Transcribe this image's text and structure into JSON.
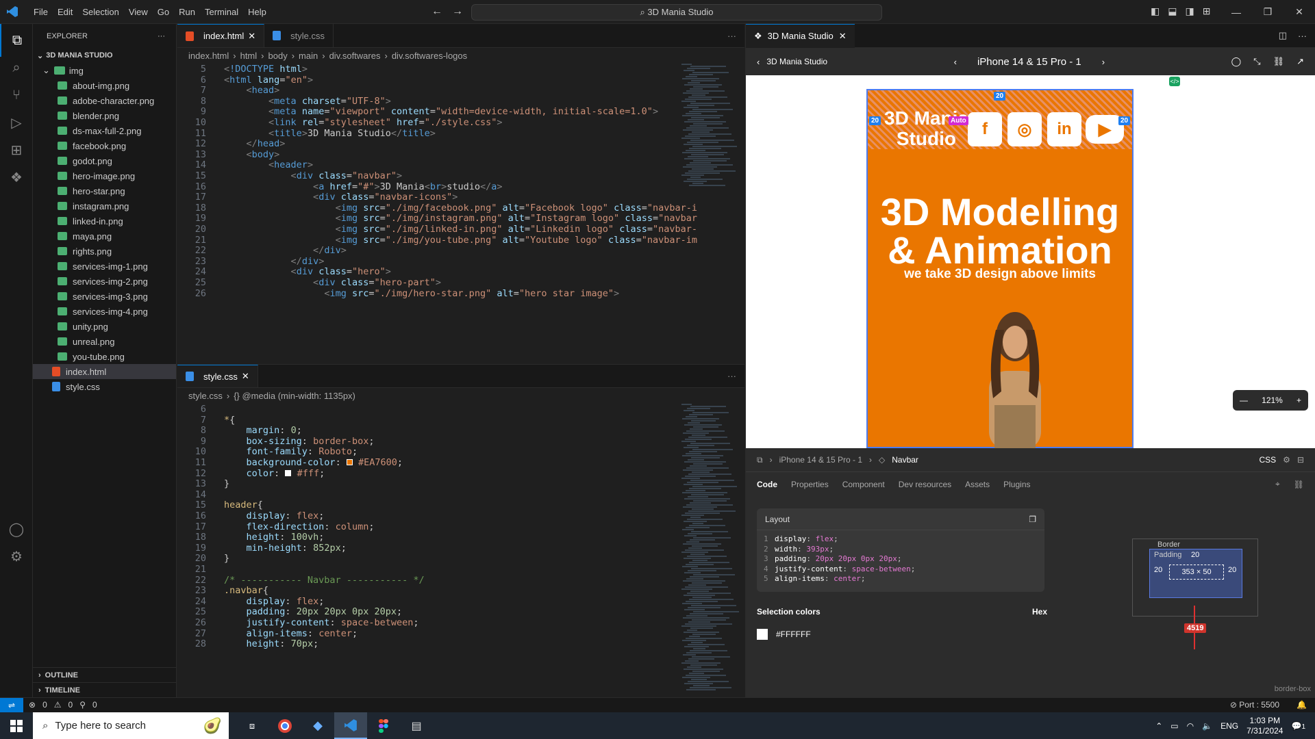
{
  "menu": [
    "File",
    "Edit",
    "Selection",
    "View",
    "Go",
    "Run",
    "Terminal",
    "Help"
  ],
  "command_center": "3D Mania Studio",
  "explorer": {
    "title": "EXPLORER",
    "project": "3D MANIA STUDIO",
    "folder": "img",
    "files": [
      "about-img.png",
      "adobe-character.png",
      "blender.png",
      "ds-max-full-2.png",
      "facebook.png",
      "godot.png",
      "hero-image.png",
      "hero-star.png",
      "instagram.png",
      "linked-in.png",
      "maya.png",
      "rights.png",
      "services-img-1.png",
      "services-img-2.png",
      "services-img-3.png",
      "services-img-4.png",
      "unity.png",
      "unreal.png",
      "you-tube.png"
    ],
    "root_files": [
      "index.html",
      "style.css"
    ],
    "outline": "OUTLINE",
    "timeline": "TIMELINE"
  },
  "editor_top": {
    "tabs": [
      "index.html",
      "style.css"
    ],
    "crumbs": [
      "index.html",
      "html",
      "body",
      "main",
      "div.softwares",
      "div.softwares-logos"
    ],
    "lines": [
      {
        "n": "5",
        "h": "<span class='gy'>&lt;</span><span class='tg'>!DOCTYPE</span> <span class='at'>html</span><span class='gy'>&gt;</span>"
      },
      {
        "n": "6",
        "h": "<span class='gy'>&lt;</span><span class='tg'>html</span> <span class='at'>lang</span>=<span class='st'>\"en\"</span><span class='gy'>&gt;</span>"
      },
      {
        "n": "7",
        "h": "    <span class='gy'>&lt;</span><span class='tg'>head</span><span class='gy'>&gt;</span>"
      },
      {
        "n": "8",
        "h": "        <span class='gy'>&lt;</span><span class='tg'>meta</span> <span class='at'>charset</span>=<span class='st'>\"UTF-8\"</span><span class='gy'>&gt;</span>"
      },
      {
        "n": "9",
        "h": "        <span class='gy'>&lt;</span><span class='tg'>meta</span> <span class='at'>name</span>=<span class='st'>\"viewport\"</span> <span class='at'>content</span>=<span class='st'>\"width=device-width, initial-scale=1.0\"</span><span class='gy'>&gt;</span>"
      },
      {
        "n": "10",
        "h": "        <span class='gy'>&lt;</span><span class='tg'>link</span> <span class='at'>rel</span>=<span class='st'>\"stylesheet\"</span> <span class='at'>href</span>=<span class='st'>\"./style.css\"</span><span class='gy'>&gt;</span>"
      },
      {
        "n": "11",
        "h": "        <span class='gy'>&lt;</span><span class='tg'>title</span><span class='gy'>&gt;</span>3D Mania Studio<span class='gy'>&lt;/</span><span class='tg'>title</span><span class='gy'>&gt;</span>"
      },
      {
        "n": "12",
        "h": "    <span class='gy'>&lt;/</span><span class='tg'>head</span><span class='gy'>&gt;</span>"
      },
      {
        "n": "13",
        "h": "    <span class='gy'>&lt;</span><span class='tg'>body</span><span class='gy'>&gt;</span>"
      },
      {
        "n": "14",
        "h": "        <span class='gy'>&lt;</span><span class='tg'>header</span><span class='gy'>&gt;</span>"
      },
      {
        "n": "15",
        "h": "            <span class='gy'>&lt;</span><span class='tg'>div</span> <span class='at'>class</span>=<span class='st'>\"navbar\"</span><span class='gy'>&gt;</span>"
      },
      {
        "n": "16",
        "h": "                <span class='gy'>&lt;</span><span class='tg'>a</span> <span class='at'>href</span>=<span class='st'>\"#\"</span><span class='gy'>&gt;</span>3D Mania<span class='gy'>&lt;</span><span class='tg'>br</span><span class='gy'>&gt;</span>studio<span class='gy'>&lt;/</span><span class='tg'>a</span><span class='gy'>&gt;</span>"
      },
      {
        "n": "17",
        "h": "                <span class='gy'>&lt;</span><span class='tg'>div</span> <span class='at'>class</span>=<span class='st'>\"navbar-icons\"</span><span class='gy'>&gt;</span>"
      },
      {
        "n": "18",
        "h": "                    <span class='gy'>&lt;</span><span class='tg'>img</span> <span class='at'>src</span>=<span class='st'>\"./img/facebook.png\"</span> <span class='at'>alt</span>=<span class='st'>\"Facebook logo\"</span> <span class='at'>class</span>=<span class='st'>\"navbar-i</span>"
      },
      {
        "n": "19",
        "h": "                    <span class='gy'>&lt;</span><span class='tg'>img</span> <span class='at'>src</span>=<span class='st'>\"./img/instagram.png\"</span> <span class='at'>alt</span>=<span class='st'>\"Instagram logo\"</span> <span class='at'>class</span>=<span class='st'>\"navbar</span>"
      },
      {
        "n": "20",
        "h": "                    <span class='gy'>&lt;</span><span class='tg'>img</span> <span class='at'>src</span>=<span class='st'>\"./img/linked-in.png\"</span> <span class='at'>alt</span>=<span class='st'>\"Linkedin logo\"</span> <span class='at'>class</span>=<span class='st'>\"navbar-</span>"
      },
      {
        "n": "21",
        "h": "                    <span class='gy'>&lt;</span><span class='tg'>img</span> <span class='at'>src</span>=<span class='st'>\"./img/you-tube.png\"</span> <span class='at'>alt</span>=<span class='st'>\"Youtube logo\"</span> <span class='at'>class</span>=<span class='st'>\"navbar-im</span>"
      },
      {
        "n": "22",
        "h": "                <span class='gy'>&lt;/</span><span class='tg'>div</span><span class='gy'>&gt;</span>"
      },
      {
        "n": "23",
        "h": "            <span class='gy'>&lt;/</span><span class='tg'>div</span><span class='gy'>&gt;</span>"
      },
      {
        "n": "24",
        "h": "            <span class='gy'>&lt;</span><span class='tg'>div</span> <span class='at'>class</span>=<span class='st'>\"hero\"</span><span class='gy'>&gt;</span>"
      },
      {
        "n": "25",
        "h": "                <span class='gy'>&lt;</span><span class='tg'>div</span> <span class='at'>class</span>=<span class='st'>\"hero-part\"</span><span class='gy'>&gt;</span>"
      },
      {
        "n": "26",
        "h": "                  <span class='gy'>&lt;</span><span class='tg'>img</span> <span class='at'>src</span>=<span class='st'>\"./img/hero-star.png\"</span> <span class='at'>alt</span>=<span class='st'>\"hero star image\"</span><span class='gy'>&gt;</span>"
      }
    ]
  },
  "editor_bottom": {
    "tab": "style.css",
    "crumbs": [
      "style.css",
      "{} @media (min-width: 1135px)"
    ],
    "lines": [
      {
        "n": "6",
        "h": ""
      },
      {
        "n": "7",
        "h": "<span class='sel'>*</span>{"
      },
      {
        "n": "8",
        "h": "    <span class='pr'>margin</span>: <span class='nm'>0</span>;"
      },
      {
        "n": "9",
        "h": "    <span class='pr'>box-sizing</span>: <span class='vl'>border-box</span>;"
      },
      {
        "n": "10",
        "h": "    <span class='pr'>font-family</span>: <span class='vl'>Roboto</span>;"
      },
      {
        "n": "11",
        "h": "    <span class='pr'>background-color</span>: <span style='display:inline-block;width:9px;height:9px;background:#EA7600;border:1px solid #fff'></span> <span class='vl'>#EA7600</span>;"
      },
      {
        "n": "12",
        "h": "    <span class='pr'>color</span>: <span style='display:inline-block;width:9px;height:9px;background:#fff;border:1px solid #fff'></span> <span class='vl'>#fff</span>;"
      },
      {
        "n": "13",
        "h": "}"
      },
      {
        "n": "14",
        "h": ""
      },
      {
        "n": "15",
        "h": "<span class='sel'>header</span>{"
      },
      {
        "n": "16",
        "h": "    <span class='pr'>display</span>: <span class='vl'>flex</span>;"
      },
      {
        "n": "17",
        "h": "    <span class='pr'>flex-direction</span>: <span class='vl'>column</span>;"
      },
      {
        "n": "18",
        "h": "    <span class='pr'>height</span>: <span class='nm'>100vh</span>;"
      },
      {
        "n": "19",
        "h": "    <span class='pr'>min-height</span>: <span class='nm'>852px</span>;"
      },
      {
        "n": "20",
        "h": "}"
      },
      {
        "n": "21",
        "h": ""
      },
      {
        "n": "22",
        "h": "<span class='cm'>/* ----------- Navbar ----------- */</span>"
      },
      {
        "n": "23",
        "h": "<span class='sel'>.navbar</span>{"
      },
      {
        "n": "24",
        "h": "    <span class='pr'>display</span>: <span class='vl'>flex</span>;"
      },
      {
        "n": "25",
        "h": "    <span class='pr'>padding</span>: <span class='nm'>20px 20px 0px 20px</span>;"
      },
      {
        "n": "26",
        "h": "    <span class='pr'>justify-content</span>: <span class='vl'>space-between</span>;"
      },
      {
        "n": "27",
        "h": "    <span class='pr'>align-items</span>: <span class='vl'>center</span>;"
      },
      {
        "n": "28",
        "h": "    <span class='pr'>height</span>: <span class='nm'>70px</span>;"
      }
    ]
  },
  "figma": {
    "tab": "3D Mania Studio",
    "back_label": "3D Mania Studio",
    "frame": "iPhone 14 & 15 Pro - 1",
    "site": {
      "logo": "3D Mania\nStudio",
      "title": "3D Modelling\n& Animation",
      "subtitle": "we take 3D design above limits"
    },
    "badges": {
      "top": "20",
      "left": "20",
      "right": "20",
      "gap": "Auto"
    },
    "zoom": "121%",
    "crumb": [
      "iPhone 14 & 15 Pro - 1",
      "Navbar"
    ],
    "lang": "CSS",
    "subtabs": [
      "Code",
      "Properties",
      "Component",
      "Dev resources",
      "Assets",
      "Plugins"
    ],
    "layout_title": "Layout",
    "layout_code": [
      [
        "1",
        "display",
        "flex"
      ],
      [
        "2",
        "width",
        "393px"
      ],
      [
        "3",
        "padding",
        "20px 20px 0px 20px"
      ],
      [
        "4",
        "justify-content",
        "space-between"
      ],
      [
        "5",
        "align-items",
        "center"
      ]
    ],
    "selection_colors": "Selection colors",
    "hex_label": "Hex",
    "color": "#FFFFFF",
    "box": {
      "border": "Border",
      "padding": "Padding",
      "pad_top": "20",
      "pad_left": "20",
      "pad_right": "20",
      "size": "353 × 50",
      "dash": "-",
      "red": "4519",
      "sizing": "border-box"
    }
  },
  "status": {
    "errors": "0",
    "warnings": "0",
    "ports": "0",
    "port": "Port : 5500"
  },
  "taskbar": {
    "search": "Type here to search",
    "time": "1:03 PM",
    "date": "7/31/2024",
    "lang": "ENG",
    "notif": "1"
  }
}
